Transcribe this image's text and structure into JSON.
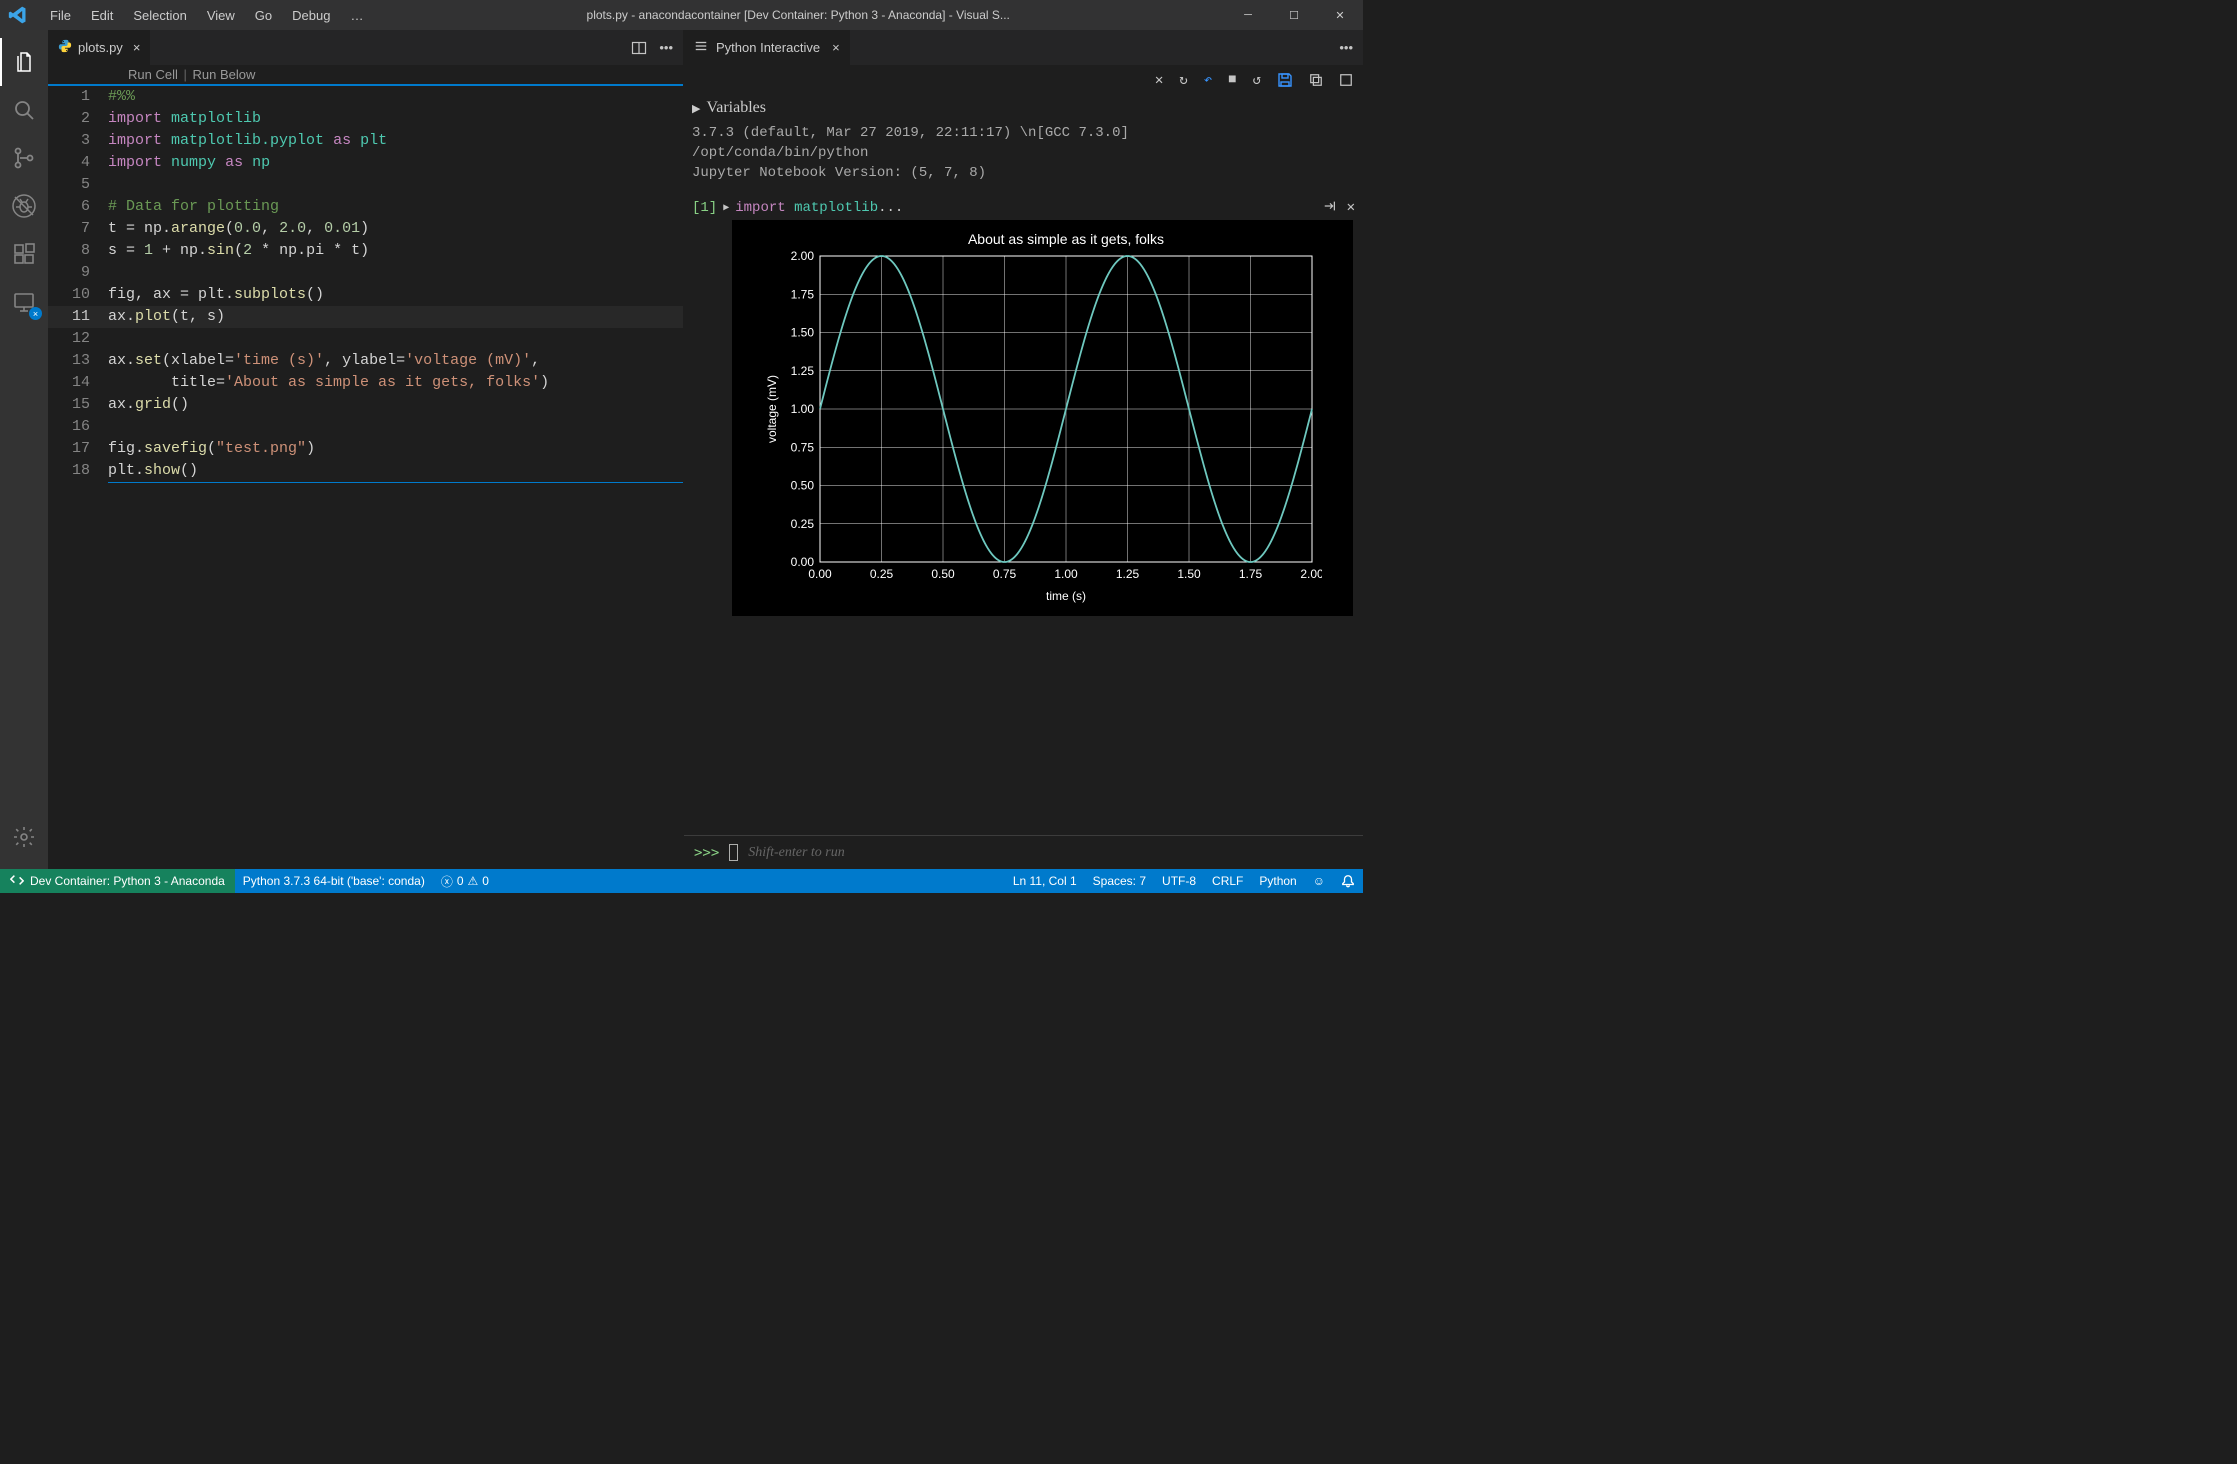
{
  "titlebar": {
    "menus": [
      "File",
      "Edit",
      "Selection",
      "View",
      "Go",
      "Debug",
      "…"
    ],
    "title": "plots.py - anacondacontainer [Dev Container: Python 3 - Anaconda] - Visual S..."
  },
  "activitybar": {
    "items": [
      "explorer-icon",
      "search-icon",
      "source-control-icon",
      "debug-icon",
      "extensions-icon",
      "remote-icon"
    ],
    "bottom": [
      "settings-icon"
    ]
  },
  "editor": {
    "tab": {
      "filename": "plots.py"
    },
    "codelens": {
      "run_cell": "Run Cell",
      "run_below": "Run Below"
    },
    "lines": [
      {
        "n": 1,
        "html": "<span class='tk-cmt'>#%%</span>"
      },
      {
        "n": 2,
        "html": "<span class='tk-kw'>import</span> <span class='tk-mod'>matplotlib</span>"
      },
      {
        "n": 3,
        "html": "<span class='tk-kw'>import</span> <span class='tk-mod'>matplotlib.pyplot</span> <span class='tk-kw'>as</span> <span class='tk-mod'>plt</span>"
      },
      {
        "n": 4,
        "html": "<span class='tk-kw'>import</span> <span class='tk-mod'>numpy</span> <span class='tk-kw'>as</span> <span class='tk-mod'>np</span>"
      },
      {
        "n": 5,
        "html": ""
      },
      {
        "n": 6,
        "html": "<span class='tk-cmt'># Data for plotting</span>"
      },
      {
        "n": 7,
        "html": "t = np.<span class='tk-fn'>arange</span>(<span class='tk-num'>0.0</span>, <span class='tk-num'>2.0</span>, <span class='tk-num'>0.01</span>)"
      },
      {
        "n": 8,
        "html": "s = <span class='tk-num'>1</span> + np.<span class='tk-fn'>sin</span>(<span class='tk-num'>2</span> * np.pi * t)"
      },
      {
        "n": 9,
        "html": ""
      },
      {
        "n": 10,
        "html": "fig, ax = plt.<span class='tk-fn'>subplots</span>()"
      },
      {
        "n": 11,
        "html": "ax.<span class='tk-fn'>plot</span>(t, s)",
        "current": true
      },
      {
        "n": 12,
        "html": ""
      },
      {
        "n": 13,
        "html": "ax.<span class='tk-fn'>set</span>(xlabel=<span class='tk-str'>'time (s)'</span>, ylabel=<span class='tk-str'>'voltage (mV)'</span>,"
      },
      {
        "n": 14,
        "html": "       title=<span class='tk-str'>'About as simple as it gets, folks'</span>)"
      },
      {
        "n": 15,
        "html": "ax.<span class='tk-fn'>grid</span>()"
      },
      {
        "n": 16,
        "html": ""
      },
      {
        "n": 17,
        "html": "fig.<span class='tk-fn'>savefig</span>(<span class='tk-str'>\"test.png\"</span>)"
      },
      {
        "n": 18,
        "html": "plt.<span class='tk-fn'>show</span>()",
        "end": true
      }
    ]
  },
  "interactive": {
    "tab_title": "Python Interactive",
    "variables_label": "Variables",
    "env_lines": [
      "3.7.3 (default, Mar 27 2019, 22:11:17) \\n[GCC 7.3.0]",
      "/opt/conda/bin/python",
      "Jupyter Notebook Version: (5, 7, 8)"
    ],
    "cell": {
      "number": "[1]",
      "summary_kw": "import",
      "summary_mod": "matplotlib",
      "summary_ellipsis": "..."
    },
    "input": {
      "prompt": ">>>",
      "placeholder": "Shift-enter to run"
    }
  },
  "chart_data": {
    "type": "line",
    "title": "About as simple as it gets, folks",
    "xlabel": "time (s)",
    "ylabel": "voltage (mV)",
    "xlim": [
      0.0,
      2.0
    ],
    "ylim": [
      0.0,
      2.0
    ],
    "xticks": [
      0.0,
      0.25,
      0.5,
      0.75,
      1.0,
      1.25,
      1.5,
      1.75,
      2.0
    ],
    "yticks": [
      0.0,
      0.25,
      0.5,
      0.75,
      1.0,
      1.25,
      1.5,
      1.75,
      2.0
    ],
    "grid": true,
    "line_color": "#6ec8bf",
    "function": "y = 1 + sin(2*pi*x)"
  },
  "statusbar": {
    "remote": "Dev Container: Python 3 - Anaconda",
    "interpreter": "Python 3.7.3 64-bit ('base': conda)",
    "errors": "0",
    "warnings": "0",
    "ln_col": "Ln 11, Col 1",
    "spaces": "Spaces: 7",
    "encoding": "UTF-8",
    "eol": "CRLF",
    "language": "Python"
  }
}
